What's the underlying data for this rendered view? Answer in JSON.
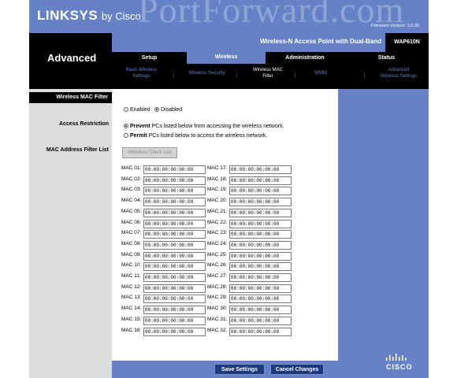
{
  "header": {
    "watermark": "PortForward.com",
    "brand": "LINKSYS",
    "brand_suffix": "by Cisco",
    "firmware": "Firmware Version: 1.0.00",
    "product_name": "Wireless-N Access Point with Dual-Band",
    "model": "WAP610N",
    "section_title": "Advanced"
  },
  "tabs": [
    "Setup",
    "Wireless",
    "Administration",
    "Status"
  ],
  "subtabs": [
    {
      "line1": "Basic Wireless",
      "line2": "Settings"
    },
    {
      "line1": "Wireless Security",
      "line2": ""
    },
    {
      "line1": "Wireless MAC",
      "line2": "Filter"
    },
    {
      "line1": "WMM",
      "line2": ""
    },
    {
      "line1": "Advanced",
      "line2": "Wireless Settings"
    }
  ],
  "left": {
    "heading": "Wireless MAC Filter",
    "access_restriction": "Access Restriction",
    "mac_filter_list": "MAC Address Filter List"
  },
  "filter": {
    "enabled": "Enabled",
    "disabled": "Disabled",
    "prevent_bold": "Prevent",
    "prevent_rest": "PCs listed below from accessing the wireless network.",
    "permit_bold": "Permit",
    "permit_rest": "PCs listed below to access the wireless network.",
    "client_list_button": "Wireless Client List"
  },
  "mac_rows": [
    {
      "l1": "MAC 01:",
      "v1": "00:00:00:00:00:00",
      "l2": "MAC 17:",
      "v2": "00:00:00:00:00:00"
    },
    {
      "l1": "MAC 02:",
      "v1": "00:00:00:00:00:00",
      "l2": "MAC 18:",
      "v2": "00:00:00:00:00:00"
    },
    {
      "l1": "MAC 03:",
      "v1": "00:00:00:00:00:00",
      "l2": "MAC 19:",
      "v2": "00:00:00:00:00:00"
    },
    {
      "l1": "MAC 04:",
      "v1": "00:00:00:00:00:00",
      "l2": "MAC 20:",
      "v2": "00:00:00:00:00:00"
    },
    {
      "l1": "MAC 05:",
      "v1": "00:00:00:00:00:00",
      "l2": "MAC 21:",
      "v2": "00:00:00:00:00:00"
    },
    {
      "l1": "MAC 06:",
      "v1": "00:00:00:00:00:00",
      "l2": "MAC 22:",
      "v2": "00:00:00:00:00:00"
    },
    {
      "l1": "MAC 07:",
      "v1": "00:00:00:00:00:00",
      "l2": "MAC 23:",
      "v2": "00:00:00:00:00:00"
    },
    {
      "l1": "MAC 08:",
      "v1": "00:00:00:00:00:00",
      "l2": "MAC 24:",
      "v2": "00:00:00:00:00:00"
    },
    {
      "l1": "MAC 09:",
      "v1": "00:00:00:00:00:00",
      "l2": "MAC 25:",
      "v2": "00:00:00:00:00:00"
    },
    {
      "l1": "MAC 10:",
      "v1": "00:00:00:00:00:00",
      "l2": "MAC 26:",
      "v2": "00:00:00:00:00:00"
    },
    {
      "l1": "MAC 11:",
      "v1": "00:00:00:00:00:00",
      "l2": "MAC 27:",
      "v2": "00:00:00:00:00:00"
    },
    {
      "l1": "MAC 12:",
      "v1": "00:00:00:00:00:00",
      "l2": "MAC 28:",
      "v2": "00:00:00:00:00:00"
    },
    {
      "l1": "MAC 13:",
      "v1": "00:00:00:00:00:00",
      "l2": "MAC 29:",
      "v2": "00:00:00:00:00:00"
    },
    {
      "l1": "MAC 14:",
      "v1": "00:00:00:00:00:00",
      "l2": "MAC 30:",
      "v2": "00:00:00:00:00:00"
    },
    {
      "l1": "MAC 15:",
      "v1": "00:00:00:00:00:00",
      "l2": "MAC 31:",
      "v2": "00:00:00:00:00:00"
    },
    {
      "l1": "MAC 16:",
      "v1": "00:00:00:00:00:00",
      "l2": "MAC 32:",
      "v2": "00:00:00:00:00:00"
    }
  ],
  "footer": {
    "save": "Save Settings",
    "cancel": "Cancel Changes",
    "cisco": "CISCO"
  },
  "colors": {
    "accent": "#6781c6",
    "button": "#1d3a7a"
  }
}
